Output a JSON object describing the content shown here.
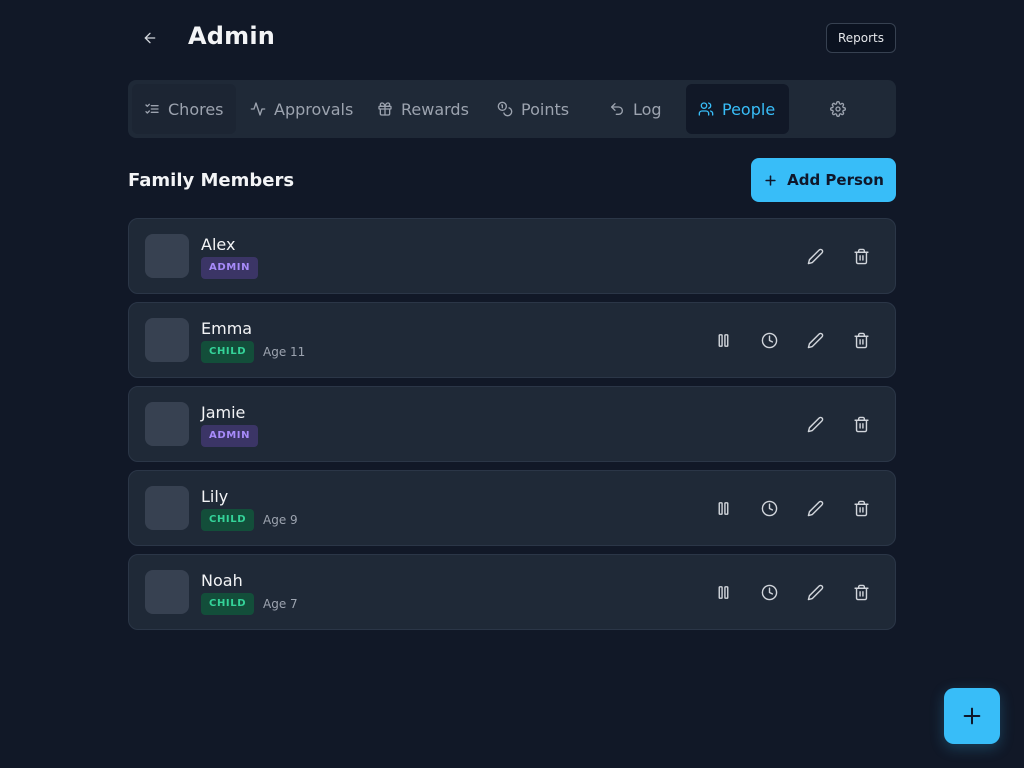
{
  "header": {
    "title": "Admin",
    "reports_label": "Reports"
  },
  "tabs": [
    {
      "label": "Chores",
      "icon": "checklist-icon"
    },
    {
      "label": "Approvals",
      "icon": "activity-icon"
    },
    {
      "label": "Rewards",
      "icon": "gift-icon"
    },
    {
      "label": "Points",
      "icon": "coins-icon"
    },
    {
      "label": "Log",
      "icon": "undo-icon"
    },
    {
      "label": "People",
      "icon": "users-icon",
      "active": true
    },
    {
      "label": "",
      "icon": "gear-icon"
    }
  ],
  "section": {
    "title": "Family Members",
    "add_label": "Add Person"
  },
  "people": [
    {
      "name": "Alex",
      "role": "ADMIN",
      "age": ""
    },
    {
      "name": "Emma",
      "role": "CHILD",
      "age": "Age 11"
    },
    {
      "name": "Jamie",
      "role": "ADMIN",
      "age": ""
    },
    {
      "name": "Lily",
      "role": "CHILD",
      "age": "Age 9"
    },
    {
      "name": "Noah",
      "role": "CHILD",
      "age": "Age 7"
    }
  ],
  "colors": {
    "background": "#111827",
    "surface": "#1f2937",
    "accent": "#38bdf8",
    "admin_badge": "#a78bfa",
    "child_badge": "#34d399"
  }
}
